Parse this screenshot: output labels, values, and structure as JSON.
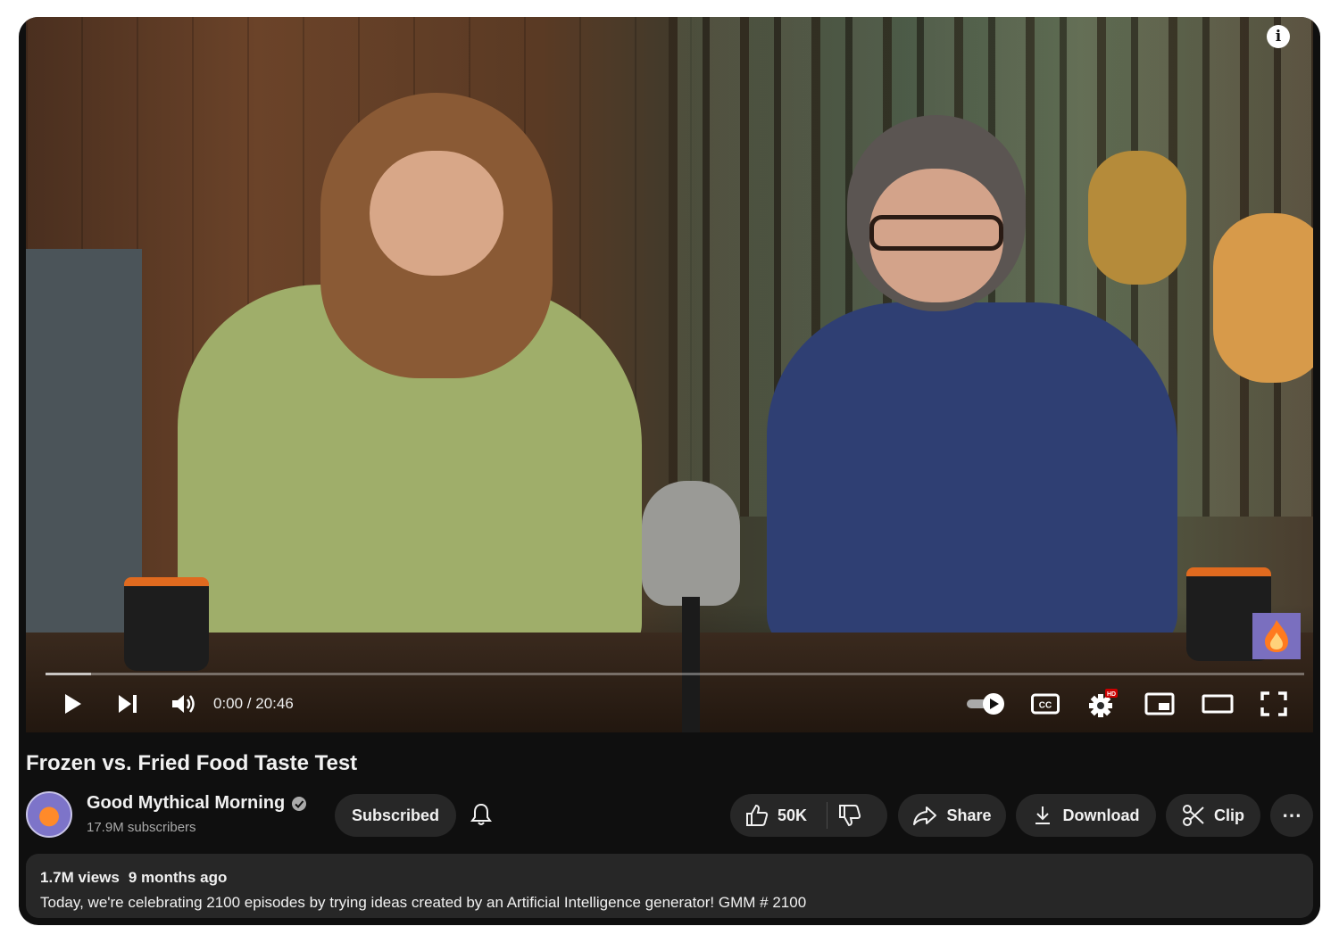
{
  "player": {
    "time_current": "0:00",
    "time_total": "20:46",
    "time_display": "0:00 / 20:46",
    "progress_loaded": 0.036,
    "progress_played": 0,
    "autoplay_on": true,
    "quality_badge": "HD"
  },
  "video": {
    "title": "Frozen vs. Fried Food Taste Test",
    "views": "1.7M views",
    "age": "9 months ago",
    "description": "Today, we're celebrating 2100 episodes by trying ideas created by an Artificial Intelligence generator! GMM # 2100"
  },
  "channel": {
    "name": "Good Mythical Morning",
    "verified": true,
    "subscribers": "17.9M subscribers",
    "subscribe_label": "Subscribed"
  },
  "actions": {
    "like_count": "50K",
    "share_label": "Share",
    "download_label": "Download",
    "clip_label": "Clip",
    "more_label": "⋯"
  },
  "icons": {
    "play": "play-icon",
    "next": "next-icon",
    "volume": "volume-icon",
    "autoplay": "autoplay-toggle-icon",
    "captions": "captions-icon",
    "settings": "settings-gear-icon",
    "miniplayer": "miniplayer-icon",
    "theater": "theater-mode-icon",
    "fullscreen": "fullscreen-icon",
    "info": "info-icon",
    "bell": "bell-icon",
    "like": "thumbs-up-icon",
    "dislike": "thumbs-down-icon",
    "share": "share-arrow-icon",
    "download": "download-icon",
    "clip": "scissors-icon"
  },
  "colors": {
    "page_bg": "#0f0f0f",
    "pill_bg": "#272727",
    "text_primary": "#f1f1f1",
    "text_secondary": "#aaaaaa",
    "hd_badge": "#cc0000"
  }
}
